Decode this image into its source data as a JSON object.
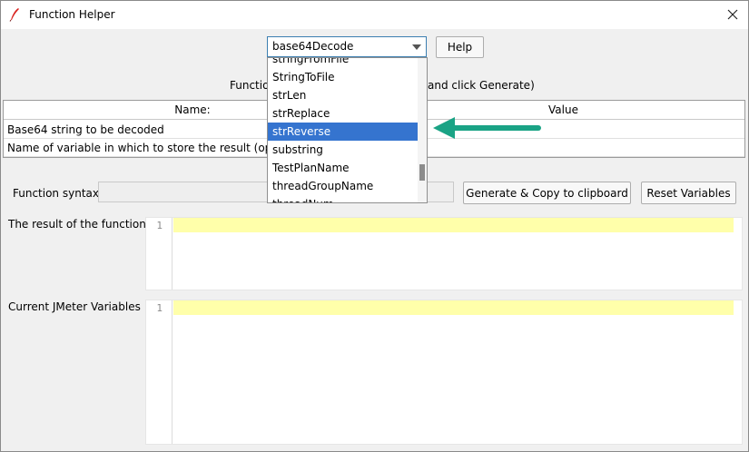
{
  "window": {
    "title": "Function Helper"
  },
  "function_select": {
    "value": "base64Decode"
  },
  "help_button": "Help",
  "instructions": {
    "left": "Functio",
    "right": "and click Generate)"
  },
  "params_table": {
    "columns": [
      "Name:",
      "Value"
    ],
    "rows": [
      {
        "name": "Base64 string to be decoded",
        "value": ""
      },
      {
        "name": "Name of variable in which to store the result (optional)",
        "value": ""
      }
    ]
  },
  "syntax": {
    "label": "Function syntax:",
    "value": ""
  },
  "generate_button": "Generate & Copy to clipboard",
  "reset_button": "Reset Variables",
  "result": {
    "label": "The result of the function is",
    "line": "1"
  },
  "variables": {
    "label": "Current JMeter Variables",
    "line": "1"
  },
  "dropdown_items": [
    "stringFromFile",
    "StringToFile",
    "strLen",
    "strReplace",
    "strReverse",
    "substring",
    "TestPlanName",
    "threadGroupName",
    "threadNum"
  ],
  "dropdown_selected": "strReverse",
  "colors": {
    "selection": "#3574cf",
    "arrow": "#1aa385",
    "highlight_line": "#ffffaa"
  }
}
